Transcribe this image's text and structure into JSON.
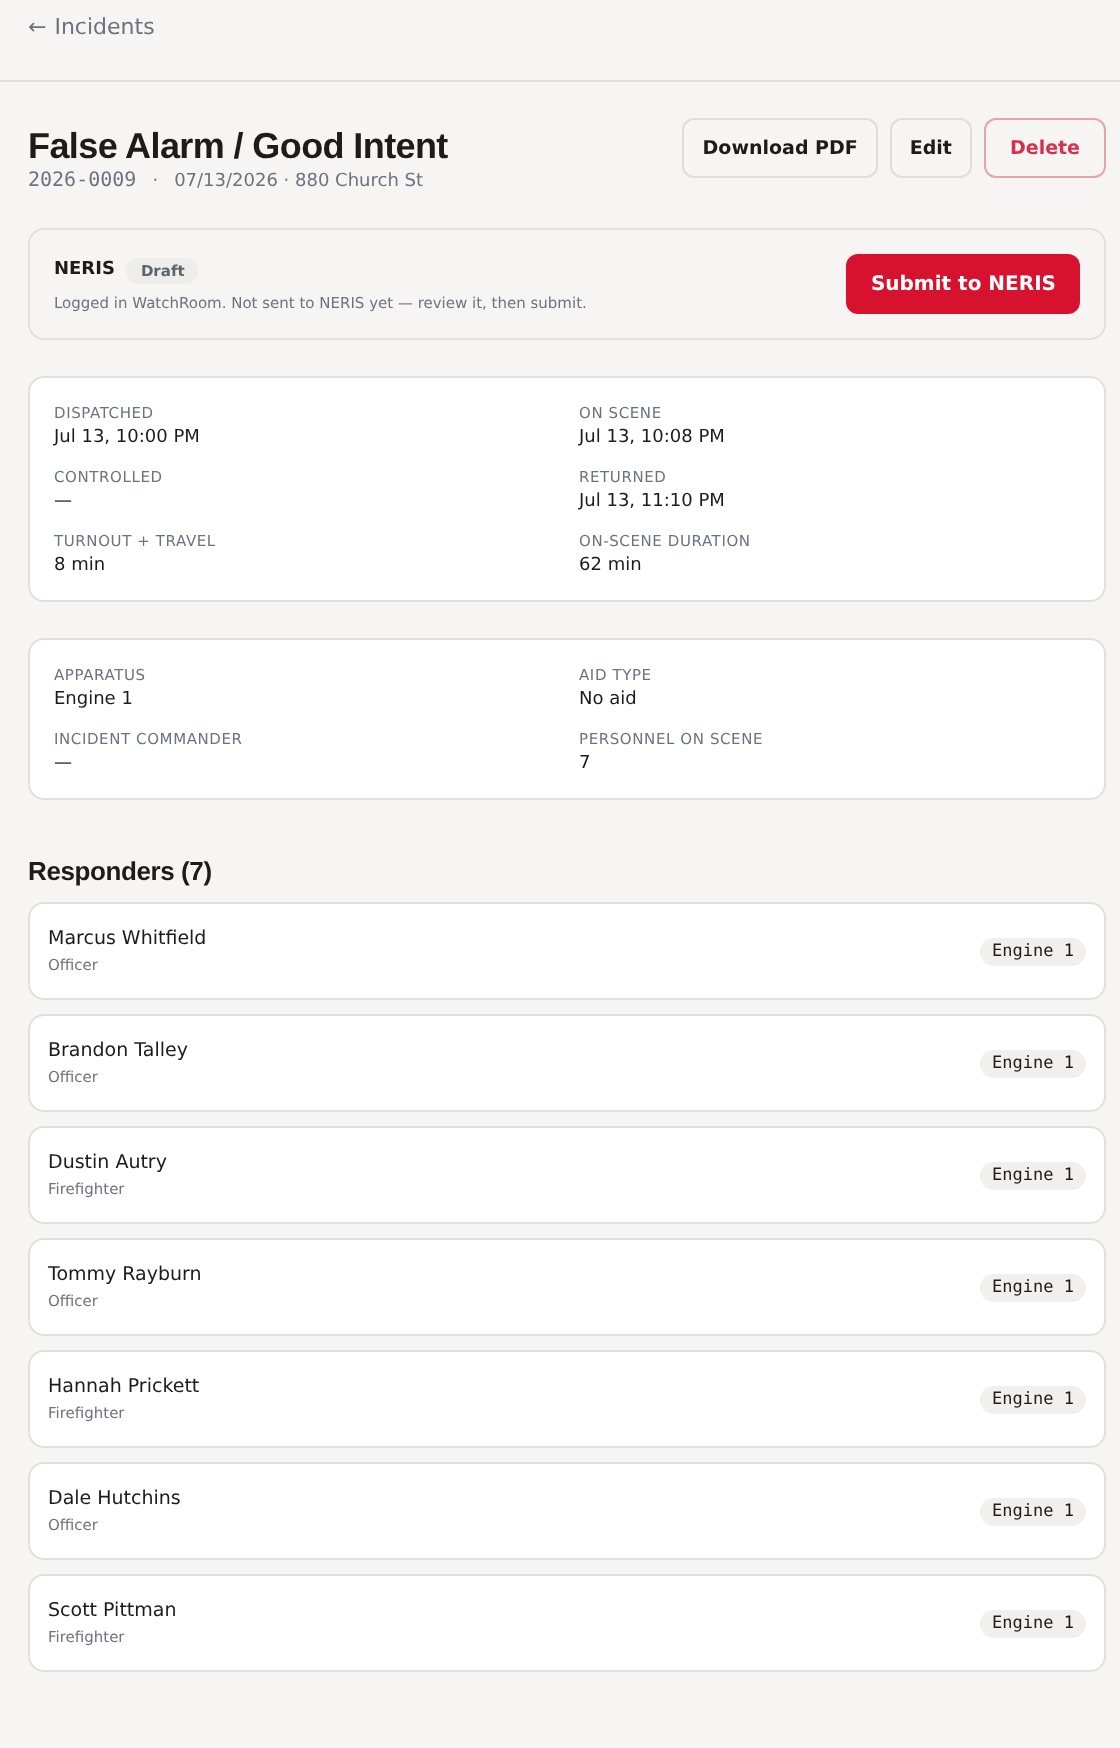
{
  "back_link": {
    "arrow": "←",
    "label": "Incidents"
  },
  "header": {
    "title": "False Alarm / Good Intent",
    "incident_number": "2026-0009",
    "separator": "·",
    "details": "07/13/2026 · 880 Church St",
    "buttons": [
      {
        "label": "Download PDF",
        "kind": "default"
      },
      {
        "label": "Edit",
        "kind": "default"
      },
      {
        "label": "Delete",
        "kind": "danger"
      }
    ]
  },
  "neris": {
    "title": "NERIS",
    "status": "Draft",
    "message": "Logged in WatchRoom. Not sent to NERIS yet — review it, then submit.",
    "button": "Submit to NERIS"
  },
  "timing": [
    {
      "label": "DISPATCHED",
      "value": "Jul 13, 10:00 PM"
    },
    {
      "label": "ON SCENE",
      "value": "Jul 13, 10:08 PM"
    },
    {
      "label": "CONTROLLED",
      "value": "—"
    },
    {
      "label": "RETURNED",
      "value": "Jul 13, 11:10 PM"
    },
    {
      "label": "TURNOUT + TRAVEL",
      "value": "8 min"
    },
    {
      "label": "ON-SCENE DURATION",
      "value": "62 min"
    }
  ],
  "resources": [
    {
      "label": "APPARATUS",
      "value": "Engine 1"
    },
    {
      "label": "AID TYPE",
      "value": "No aid"
    },
    {
      "label": "INCIDENT COMMANDER",
      "value": "—"
    },
    {
      "label": "PERSONNEL ON SCENE",
      "value": "7"
    }
  ],
  "responders": {
    "heading": "Responders (7)",
    "items": [
      {
        "name": "Marcus Whitfield",
        "role": "Officer",
        "unit": "Engine 1"
      },
      {
        "name": "Brandon Talley",
        "role": "Officer",
        "unit": "Engine 1"
      },
      {
        "name": "Dustin Autry",
        "role": "Firefighter",
        "unit": "Engine 1"
      },
      {
        "name": "Tommy Rayburn",
        "role": "Officer",
        "unit": "Engine 1"
      },
      {
        "name": "Hannah Prickett",
        "role": "Firefighter",
        "unit": "Engine 1"
      },
      {
        "name": "Dale Hutchins",
        "role": "Officer",
        "unit": "Engine 1"
      },
      {
        "name": "Scott Pittman",
        "role": "Firefighter",
        "unit": "Engine 1"
      }
    ]
  }
}
